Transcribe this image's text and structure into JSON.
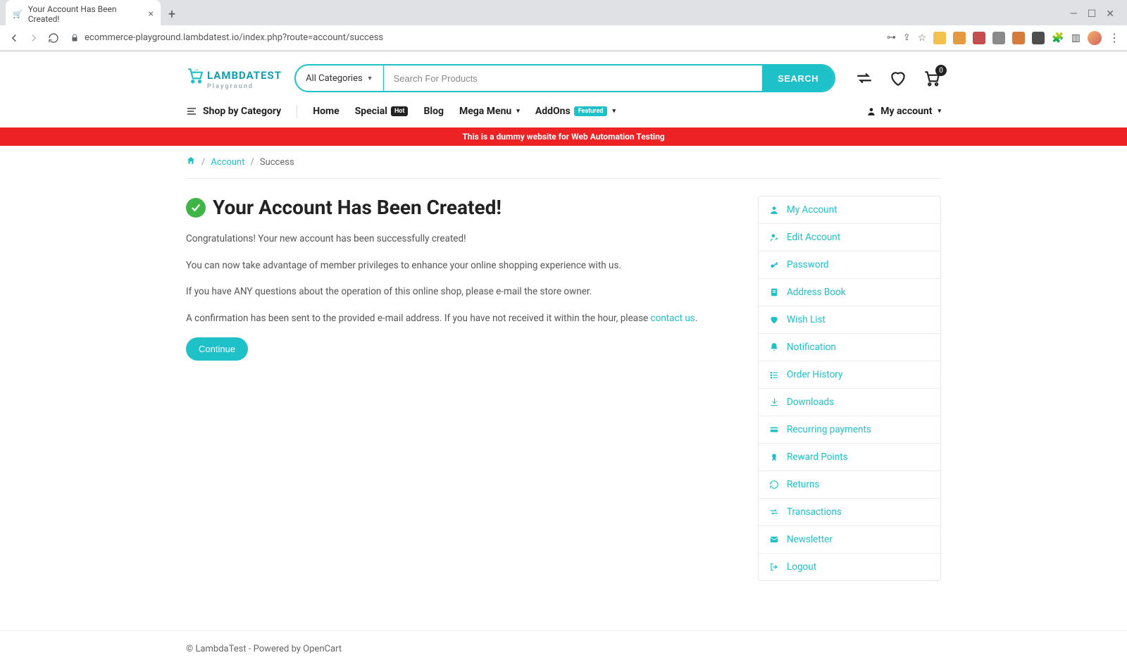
{
  "browser": {
    "tab_title": "Your Account Has Been Created!",
    "url": "ecommerce-playground.lambdatest.io/index.php?route=account/success"
  },
  "logo": {
    "main": "LAMBDATEST",
    "sub": "Playground"
  },
  "search": {
    "category_label": "All Categories",
    "placeholder": "Search For Products",
    "button": "SEARCH"
  },
  "cart_count": "0",
  "nav": {
    "shop_by_category": "Shop by Category",
    "home": "Home",
    "special": "Special",
    "special_badge": "Hot",
    "blog": "Blog",
    "mega_menu": "Mega Menu",
    "addons": "AddOns",
    "addons_badge": "Featured",
    "my_account": "My account"
  },
  "banner": "This is a dummy website for Web Automation Testing",
  "breadcrumb": {
    "account": "Account",
    "current": "Success"
  },
  "main": {
    "title": "Your Account Has Been Created!",
    "p1": "Congratulations! Your new account has been successfully created!",
    "p2": "You can now take advantage of member privileges to enhance your online shopping experience with us.",
    "p3": "If you have ANY questions about the operation of this online shop, please e-mail the store owner.",
    "p4_pre": "A confirmation has been sent to the provided e-mail address. If you have not received it within the hour, please ",
    "p4_link": "contact us",
    "p4_post": ".",
    "continue": "Continue"
  },
  "sidebar": {
    "items": [
      {
        "label": "My Account",
        "icon": "user"
      },
      {
        "label": "Edit Account",
        "icon": "user-edit"
      },
      {
        "label": "Password",
        "icon": "key"
      },
      {
        "label": "Address Book",
        "icon": "address"
      },
      {
        "label": "Wish List",
        "icon": "heart"
      },
      {
        "label": "Notification",
        "icon": "bell"
      },
      {
        "label": "Order History",
        "icon": "list"
      },
      {
        "label": "Downloads",
        "icon": "download"
      },
      {
        "label": "Recurring payments",
        "icon": "credit"
      },
      {
        "label": "Reward Points",
        "icon": "award"
      },
      {
        "label": "Returns",
        "icon": "undo"
      },
      {
        "label": "Transactions",
        "icon": "exchange"
      },
      {
        "label": "Newsletter",
        "icon": "mail"
      },
      {
        "label": "Logout",
        "icon": "logout"
      }
    ]
  },
  "footer": "© LambdaTest - Powered by OpenCart"
}
